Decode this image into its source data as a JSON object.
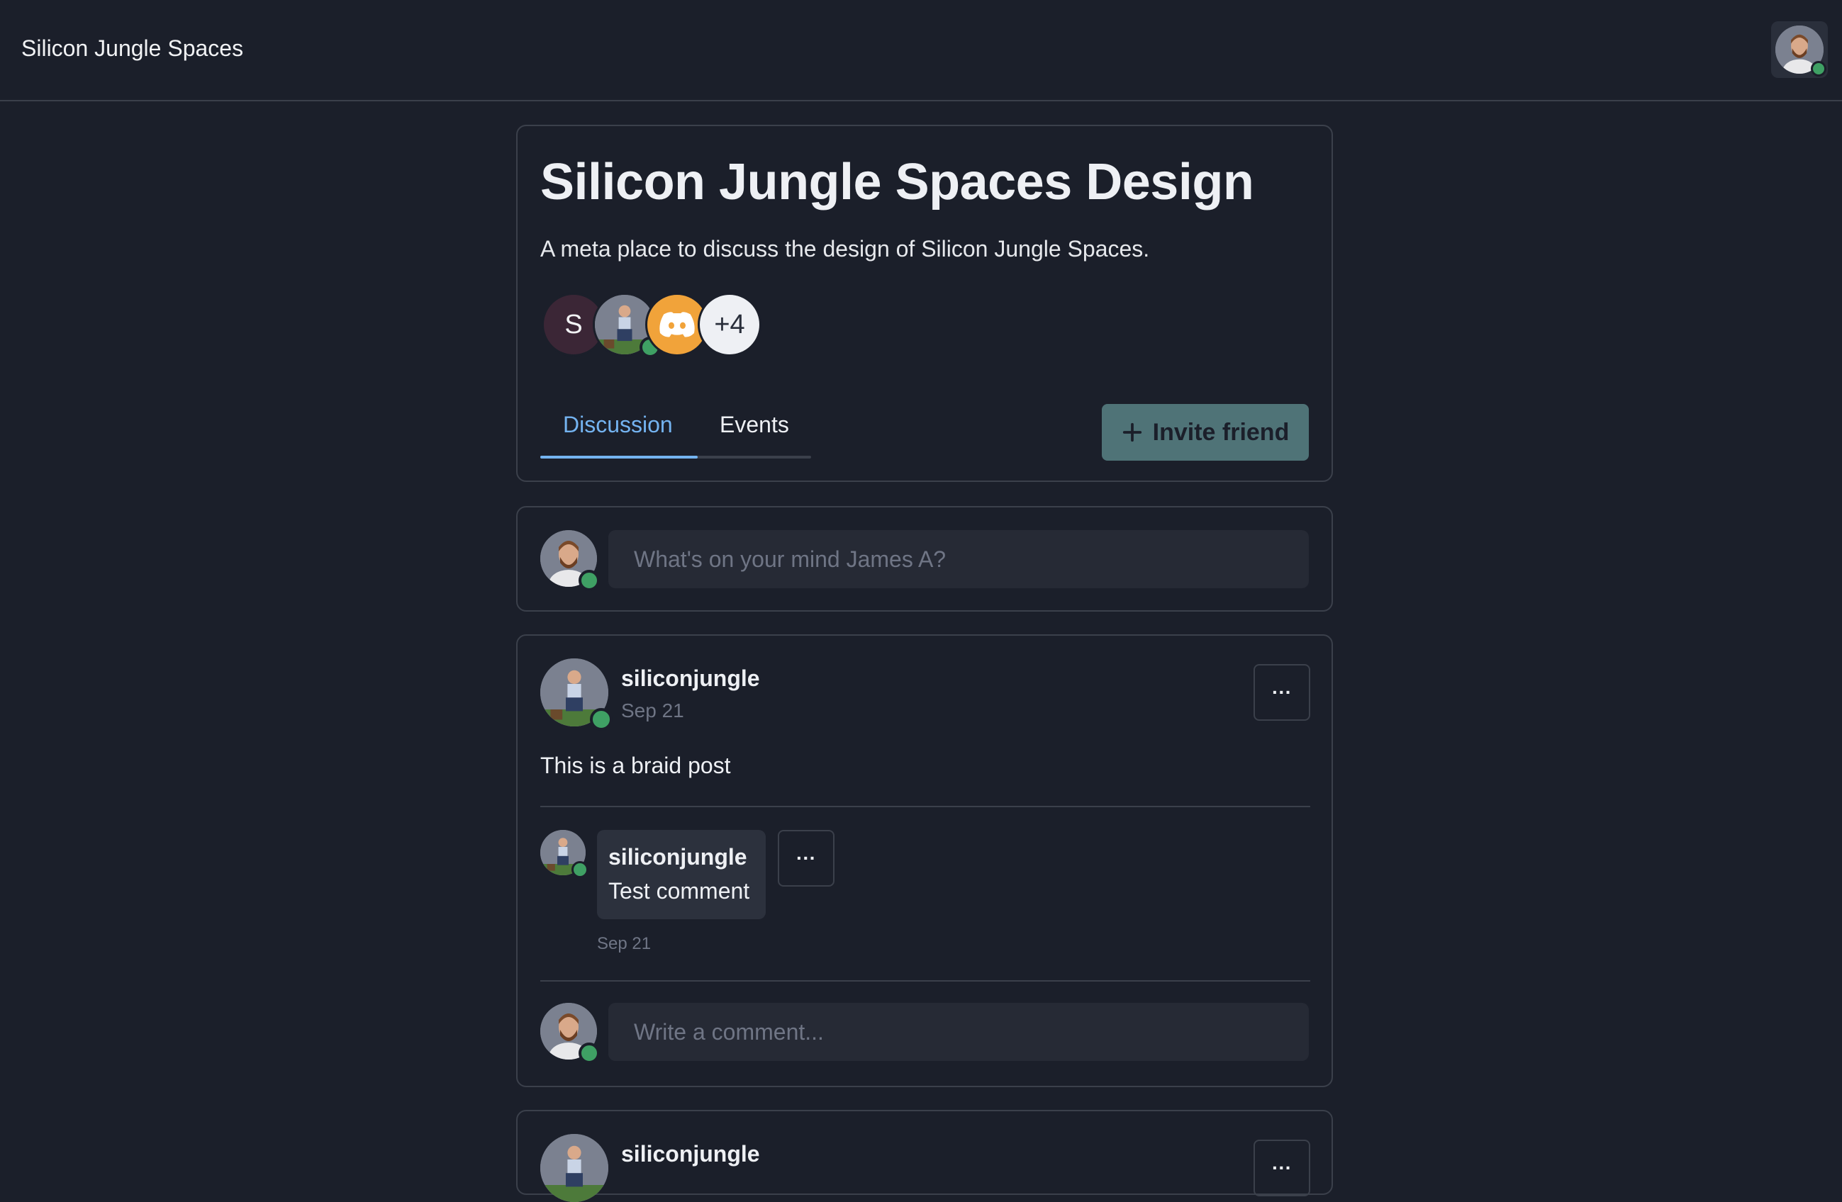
{
  "app": {
    "title": "Silicon Jungle Spaces"
  },
  "space": {
    "title": "Silicon Jungle Spaces Design",
    "description": "A meta place to discuss the design of Silicon Jungle Spaces.",
    "members": {
      "first_initial": "S",
      "more_count": "+4"
    },
    "tabs": [
      {
        "label": "Discussion",
        "active": true
      },
      {
        "label": "Events",
        "active": false
      }
    ],
    "invite_label": "Invite friend"
  },
  "composer": {
    "placeholder": "What's on your mind James A?"
  },
  "posts": [
    {
      "author": "siliconjungle",
      "date": "Sep 21",
      "body": "This is a braid post",
      "comments": [
        {
          "author": "siliconjungle",
          "text": "Test comment",
          "date": "Sep 21"
        }
      ],
      "comment_placeholder": "Write a comment...",
      "more_label": "···"
    },
    {
      "author": "siliconjungle",
      "more_label": "···"
    }
  ],
  "colors": {
    "background": "#1b1f2a",
    "accent_tab": "#74b3f0",
    "invite_button": "#4f7377",
    "presence_online": "#3fa064",
    "member_s_bg": "#3b2636",
    "discord_bg": "#f1a33a"
  },
  "icons": {
    "plus": "plus-icon",
    "more": "more-horizontal-icon",
    "discord": "discord-icon"
  }
}
